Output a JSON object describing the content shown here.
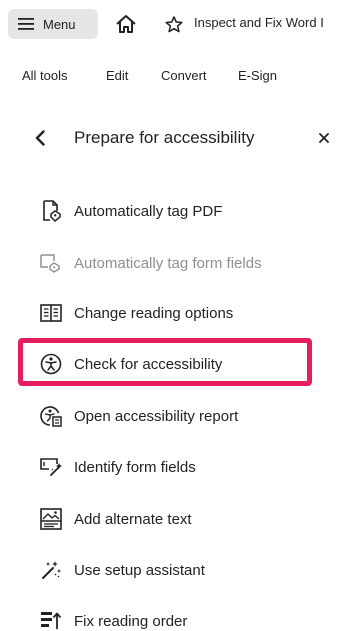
{
  "topbar": {
    "menu_label": "Menu",
    "home_icon": "home-icon",
    "star_icon": "star-icon",
    "document_title": "Inspect and Fix Word I"
  },
  "tabs": [
    "All tools",
    "Edit",
    "Convert",
    "E-Sign"
  ],
  "panel": {
    "title": "Prepare for accessibility",
    "back_icon": "chevron-left-icon",
    "close_icon": "close-icon"
  },
  "tools": [
    {
      "label": "Automatically tag PDF",
      "icon": "autotag-pdf-icon",
      "enabled": true
    },
    {
      "label": "Automatically tag form fields",
      "icon": "autotag-form-icon",
      "enabled": false
    },
    {
      "label": "Change reading options",
      "icon": "book-icon",
      "enabled": true
    },
    {
      "label": "Check for accessibility",
      "icon": "accessibility-icon",
      "enabled": true,
      "highlighted": true
    },
    {
      "label": "Open accessibility report",
      "icon": "accessibility-report-icon",
      "enabled": true
    },
    {
      "label": "Identify form fields",
      "icon": "form-field-icon",
      "enabled": true
    },
    {
      "label": "Add alternate text",
      "icon": "image-alt-icon",
      "enabled": true
    },
    {
      "label": "Use setup assistant",
      "icon": "wand-icon",
      "enabled": true
    },
    {
      "label": "Fix reading order",
      "icon": "reading-order-icon",
      "enabled": true
    }
  ],
  "colors": {
    "highlight": "#e61e5c",
    "menu_bg": "#e6e6e6",
    "disabled_text": "#8f8f8f"
  }
}
